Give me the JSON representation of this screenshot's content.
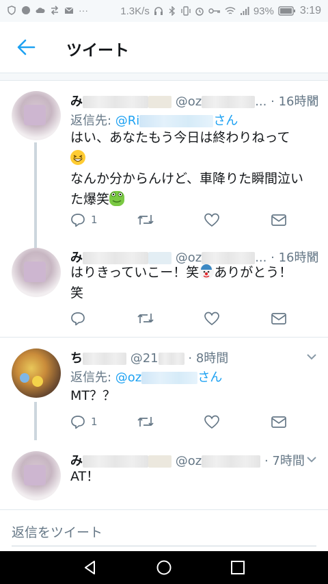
{
  "status_bar": {
    "net_speed": "1.3K/s",
    "battery": "93%",
    "time": "3:19"
  },
  "header": {
    "title": "ツイート"
  },
  "tweets": [
    {
      "name": "み",
      "handle": "@oz",
      "dots": "...",
      "time": "16時間",
      "reply_label": "返信先: ",
      "reply_mention": "@Ri",
      "reply_suffix": "さん",
      "line1": "はい、あなたもう今日は終わりねって",
      "line2": "なんか分からんけど、車降りた瞬間泣い",
      "line3": "た爆笑",
      "reply_count": "1"
    },
    {
      "name": "み",
      "handle": "@oz",
      "dots": "...",
      "time": "16時間",
      "line1a": "はりきっていこー！笑",
      "line1b": "ありがとう！",
      "line2": "笑"
    },
    {
      "name": "ち",
      "handle": "@21",
      "time": "8時間",
      "reply_label": "返信先: ",
      "reply_mention": "@oz",
      "reply_suffix": "さん",
      "line1": "MT？？",
      "reply_count": "1"
    },
    {
      "name": "み",
      "handle": "@oz",
      "time": "7時間",
      "line1": "AT！"
    }
  ],
  "compose": {
    "placeholder": "返信をツイート"
  },
  "colors": {
    "accent": "#1da1f2",
    "muted": "#657786",
    "text": "#14171a",
    "divider": "#e1e8ed"
  },
  "icons": [
    "back-arrow-icon",
    "caret-down-icon",
    "reply-icon",
    "retweet-icon",
    "like-icon",
    "dm-icon",
    "nav-back-icon",
    "nav-home-icon",
    "nav-recents-icon"
  ]
}
